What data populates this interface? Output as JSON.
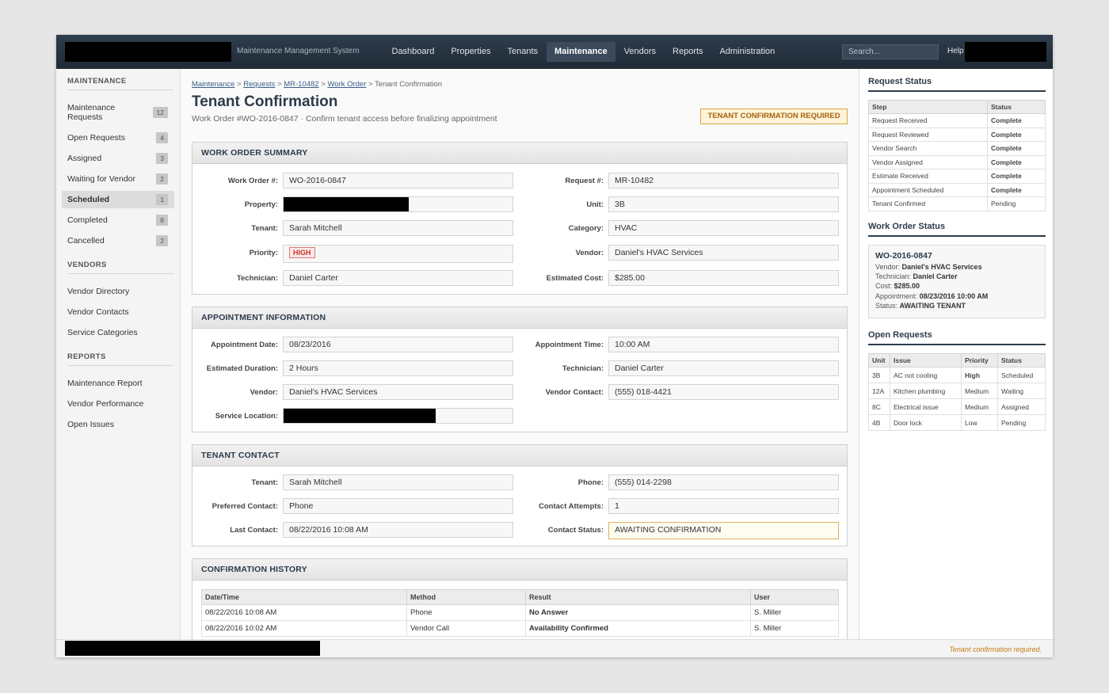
{
  "header": {
    "system_name": "Maintenance Management System",
    "nav": [
      "Dashboard",
      "Properties",
      "Tenants",
      "Maintenance",
      "Vendors",
      "Reports",
      "Administration"
    ],
    "active_nav": "Maintenance",
    "search_placeholder": "Search...",
    "help": "Help"
  },
  "sidebar": {
    "maintenance_heading": "MAINTENANCE",
    "maintenance_items": [
      {
        "label": "Maintenance Requests",
        "count": "12"
      },
      {
        "label": "Open Requests",
        "count": "4"
      },
      {
        "label": "Assigned",
        "count": "3"
      },
      {
        "label": "Waiting for Vendor",
        "count": "2"
      },
      {
        "label": "Scheduled",
        "count": "1"
      },
      {
        "label": "Completed",
        "count": "8"
      },
      {
        "label": "Cancelled",
        "count": "2"
      }
    ],
    "vendors_heading": "VENDORS",
    "vendor_items": [
      "Vendor Directory",
      "Vendor Contacts",
      "Service Categories"
    ],
    "reports_heading": "REPORTS",
    "report_items": [
      "Maintenance Report",
      "Vendor Performance",
      "Open Issues"
    ]
  },
  "breadcrumb": {
    "items": [
      "Maintenance",
      "Requests",
      "MR-10482",
      "Work Order"
    ],
    "current": "Tenant Confirmation",
    "sep": ">"
  },
  "page": {
    "title": "Tenant Confirmation",
    "subtitle": "Work Order #WO-2016-0847 · Confirm tenant access before finalizing appointment",
    "flag": "TENANT CONFIRMATION REQUIRED"
  },
  "summary": {
    "heading": "WORK ORDER SUMMARY",
    "work_order_label": "Work Order #:",
    "work_order": "WO-2016-0847",
    "request_label": "Request #:",
    "request": "MR-10482",
    "property_label": "Property:",
    "unit_label": "Unit:",
    "unit": "3B",
    "tenant_label": "Tenant:",
    "tenant": "Sarah Mitchell",
    "category_label": "Category:",
    "category": "HVAC",
    "priority_label": "Priority:",
    "priority": "HIGH",
    "vendor_label": "Vendor:",
    "vendor": "Daniel's HVAC Services",
    "technician_label": "Technician:",
    "technician": "Daniel Carter",
    "cost_label": "Estimated Cost:",
    "cost": "$285.00"
  },
  "appointment": {
    "heading": "APPOINTMENT INFORMATION",
    "date_label": "Appointment Date:",
    "date": "08/23/2016",
    "time_label": "Appointment Time:",
    "time": "10:00 AM",
    "duration_label": "Estimated Duration:",
    "duration": "2 Hours",
    "technician_label": "Technician:",
    "technician": "Daniel Carter",
    "vendor_label": "Vendor:",
    "vendor": "Daniel's HVAC Services",
    "vendor_contact_label": "Vendor Contact:",
    "vendor_contact": "(555) 018-4421",
    "location_label": "Service Location:"
  },
  "tenant_contact": {
    "heading": "TENANT CONTACT",
    "tenant_label": "Tenant:",
    "tenant": "Sarah Mitchell",
    "phone_label": "Phone:",
    "phone": "(555) 014-2298",
    "preferred_label": "Preferred Contact:",
    "preferred": "Phone",
    "attempts_label": "Contact Attempts:",
    "attempts": "1",
    "last_label": "Last Contact:",
    "last": "08/22/2016 10:08 AM",
    "status_label": "Contact Status:",
    "status": "AWAITING CONFIRMATION"
  },
  "history": {
    "heading": "CONFIRMATION HISTORY",
    "columns": [
      "Date/Time",
      "Method",
      "Result",
      "User"
    ],
    "rows": [
      {
        "datetime": "08/22/2016 10:08 AM",
        "method": "Phone",
        "result": "No Answer",
        "user": "S. Miller"
      },
      {
        "datetime": "08/22/2016 10:02 AM",
        "method": "Vendor Call",
        "result": "Availability Confirmed",
        "user": "S. Miller"
      }
    ]
  },
  "request_status": {
    "heading": "Request Status",
    "columns": [
      "Step",
      "Status"
    ],
    "rows": [
      {
        "step": "Request Received",
        "status": "Complete"
      },
      {
        "step": "Request Reviewed",
        "status": "Complete"
      },
      {
        "step": "Vendor Search",
        "status": "Complete"
      },
      {
        "step": "Vendor Assigned",
        "status": "Complete"
      },
      {
        "step": "Estimate Received",
        "status": "Complete"
      },
      {
        "step": "Appointment Scheduled",
        "status": "Complete"
      },
      {
        "step": "Tenant Confirmed",
        "status": "Pending"
      }
    ]
  },
  "work_order_status": {
    "heading": "Work Order Status",
    "id": "WO-2016-0847",
    "vendor_label": "Vendor:",
    "vendor": "Daniel's HVAC Services",
    "technician_label": "Technician:",
    "technician": "Daniel Carter",
    "cost_label": "Cost:",
    "cost": "$285.00",
    "appointment_label": "Appointment:",
    "appointment": "08/23/2016 10:00 AM",
    "status_label": "Status:",
    "status": "AWAITING TENANT"
  },
  "open_requests": {
    "heading": "Open Requests",
    "columns": [
      "Unit",
      "Issue",
      "Priority",
      "Status"
    ],
    "rows": [
      {
        "unit": "3B",
        "issue": "AC not cooling",
        "priority": "High",
        "status": "Scheduled"
      },
      {
        "unit": "12A",
        "issue": "Kitchen plumbing",
        "priority": "Medium",
        "status": "Waiting"
      },
      {
        "unit": "8C",
        "issue": "Electrical issue",
        "priority": "Medium",
        "status": "Assigned"
      },
      {
        "unit": "4B",
        "issue": "Door lock",
        "priority": "Low",
        "status": "Pending"
      }
    ]
  },
  "footer": {
    "note": "Tenant confirmation required."
  }
}
